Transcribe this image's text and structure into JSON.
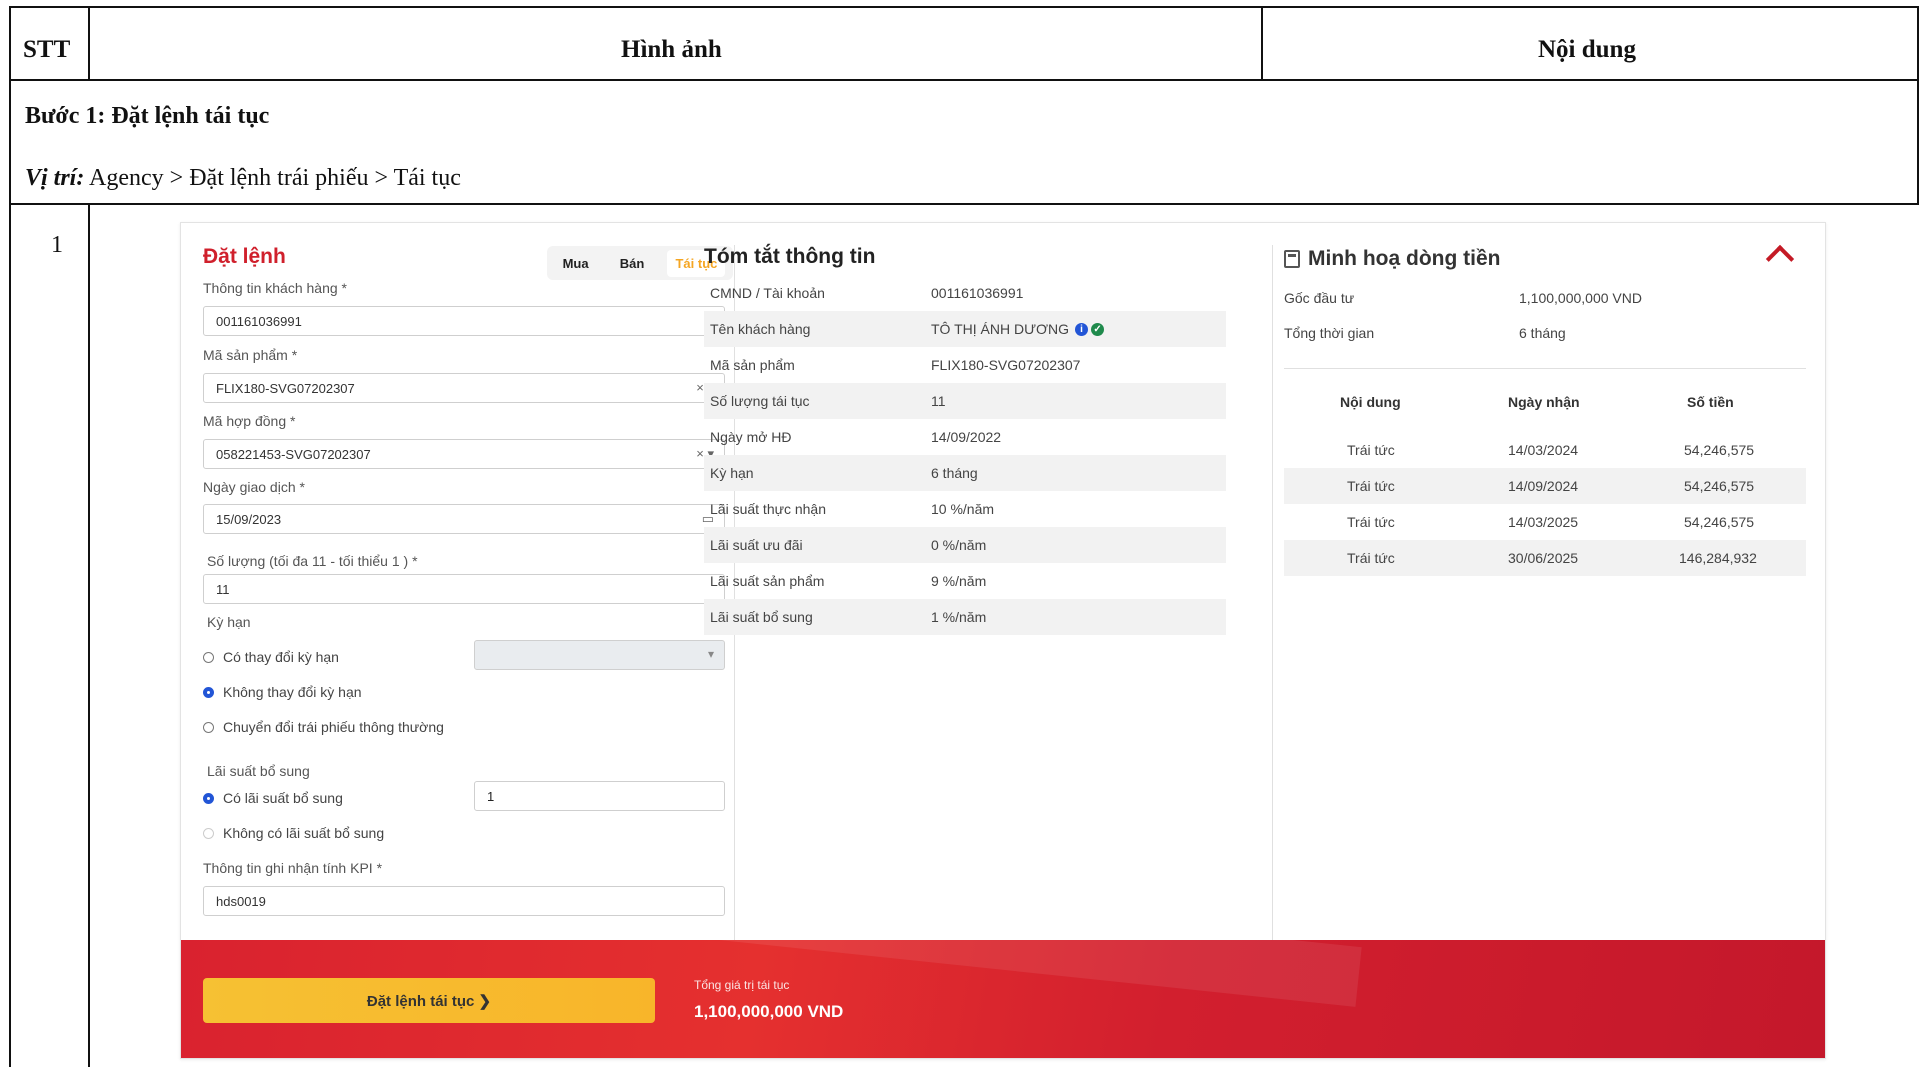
{
  "table": {
    "headers": {
      "stt": "STT",
      "image": "Hình ảnh",
      "content": "Nội dung"
    },
    "step_title": "Bước 1: Đặt lệnh tái tục",
    "location_label": "Vị trí:",
    "location_path": "Agency > Đặt lệnh trái phiếu > Tái tục",
    "row_number": "1"
  },
  "order_form": {
    "title": "Đặt lệnh",
    "tabs": [
      {
        "label": "Mua"
      },
      {
        "label": "Bán"
      },
      {
        "label": "Tái tục",
        "active": true
      }
    ],
    "customer_label": "Thông tin khách hàng *",
    "customer_value": "001161036991",
    "product_label": "Mã sản phẩm *",
    "product_value": "FLIX180-SVG07202307",
    "contract_label": "Mã hợp đồng *",
    "contract_value": "058221453-SVG07202307",
    "date_label": "Ngày giao dịch *",
    "date_value": "15/09/2023",
    "quantity_label": "Số lượng (tối đa 11 - tối thiểu 1 ) *",
    "quantity_value": "11",
    "term_label": "Kỳ hạn",
    "term_options": [
      {
        "label": "Có thay đổi kỳ hạn",
        "selected": false
      },
      {
        "label": "Không thay đổi kỳ hạn",
        "selected": true
      },
      {
        "label": "Chuyển đổi trái phiếu thông thường",
        "selected": false
      }
    ],
    "extra_rate_label": "Lãi suất bổ sung",
    "extra_rate_options": [
      {
        "label": "Có lãi suất bổ sung",
        "selected": true
      },
      {
        "label": "Không có lãi suất bổ sung",
        "selected": false
      }
    ],
    "extra_rate_value": "1",
    "kpi_label": "Thông tin ghi nhận tính KPI *",
    "kpi_value": "hds0019"
  },
  "summary": {
    "title": "Tóm tắt thông tin",
    "rows": [
      {
        "key": "CMND / Tài khoản",
        "value": "001161036991"
      },
      {
        "key": "Tên khách hàng",
        "value": "TÔ THỊ ÁNH DƯƠNG"
      },
      {
        "key": "Mã sản phẩm",
        "value": "FLIX180-SVG07202307"
      },
      {
        "key": "Số lượng tái tục",
        "value": "11"
      },
      {
        "key": "Ngày mở HĐ",
        "value": "14/09/2022"
      },
      {
        "key": "Kỳ hạn",
        "value": "6 tháng"
      },
      {
        "key": "Lãi suất thực nhận",
        "value": "10 %/năm"
      },
      {
        "key": "Lãi suất ưu đãi",
        "value": "0 %/năm"
      },
      {
        "key": "Lãi suất sản phẩm",
        "value": "9 %/năm"
      },
      {
        "key": "Lãi suất bổ sung",
        "value": "1 %/năm"
      }
    ],
    "info_glyph": "i",
    "check_glyph": "✓"
  },
  "cashflow": {
    "title": "Minh hoạ dòng tiền",
    "principal_label": "Gốc đầu tư",
    "principal_value": "1,100,000,000 VND",
    "duration_label": "Tổng thời gian",
    "duration_value": "6 tháng",
    "columns": [
      "Nội dung",
      "Ngày nhận",
      "Số tiền"
    ],
    "rows": [
      [
        "Trái tức",
        "14/03/2024",
        "54,246,575"
      ],
      [
        "Trái tức",
        "14/09/2024",
        "54,246,575"
      ],
      [
        "Trái tức",
        "14/03/2025",
        "54,246,575"
      ],
      [
        "Trái tức",
        "30/06/2025",
        "146,284,932"
      ]
    ]
  },
  "footer": {
    "button_label": "Đặt lệnh tái tục ❯",
    "total_label": "Tổng giá trị tái tục",
    "total_value": "1,100,000,000 VND"
  },
  "colors": {
    "brand_red": "#d0202c",
    "accent_yellow": "#f6c133",
    "active_tab": "#f5a623",
    "radio_blue": "#2255d6"
  }
}
